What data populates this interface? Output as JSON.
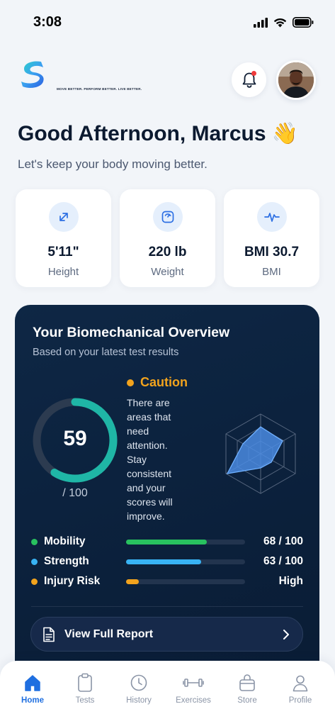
{
  "status_bar": {
    "time": "3:08"
  },
  "header": {
    "logo_letter": "S",
    "logo_tagline": "MOVE BETTER. PERFORM BETTER. LIVE BETTER."
  },
  "greeting": {
    "title": "Good Afternoon, Marcus 👋",
    "subtitle": "Let's keep your body moving better."
  },
  "stats": [
    {
      "value": "5'11\"",
      "label": "Height",
      "icon": "arrows-diagonal-icon"
    },
    {
      "value": "220 lb",
      "label": "Weight",
      "icon": "scale-icon"
    },
    {
      "value": "BMI 30.7",
      "label": "BMI",
      "icon": "pulse-icon"
    }
  ],
  "overview": {
    "title": "Your Biomechanical Overview",
    "subtitle": "Based on your latest test results",
    "score": "59",
    "score_max": "/ 100",
    "score_fraction": 0.59,
    "status_label": "Caution",
    "status_desc": "There are areas that need attention. Stay consistent and your scores will improve.",
    "metrics": [
      {
        "name": "Mobility",
        "score": "68 / 100",
        "fraction": 0.68,
        "color": "#28c15f"
      },
      {
        "name": "Strength",
        "score": "63 / 100",
        "fraction": 0.63,
        "color": "#38b3f4"
      },
      {
        "name": "Injury Risk",
        "score": "High",
        "fraction": 0.11,
        "color": "#f2a31d"
      }
    ],
    "report_button": "View Full Report"
  },
  "colors": {
    "accent": "#1f6fe0",
    "ring": "#1fb6a6",
    "caution": "#f2a31d"
  },
  "tabs": [
    {
      "label": "Home",
      "icon": "home-icon",
      "active": true
    },
    {
      "label": "Tests",
      "icon": "clipboard-icon",
      "active": false
    },
    {
      "label": "History",
      "icon": "clock-icon",
      "active": false
    },
    {
      "label": "Exercises",
      "icon": "dumbbell-icon",
      "active": false
    },
    {
      "label": "Store",
      "icon": "bag-icon",
      "active": false
    },
    {
      "label": "Profile",
      "icon": "user-icon",
      "active": false
    }
  ]
}
